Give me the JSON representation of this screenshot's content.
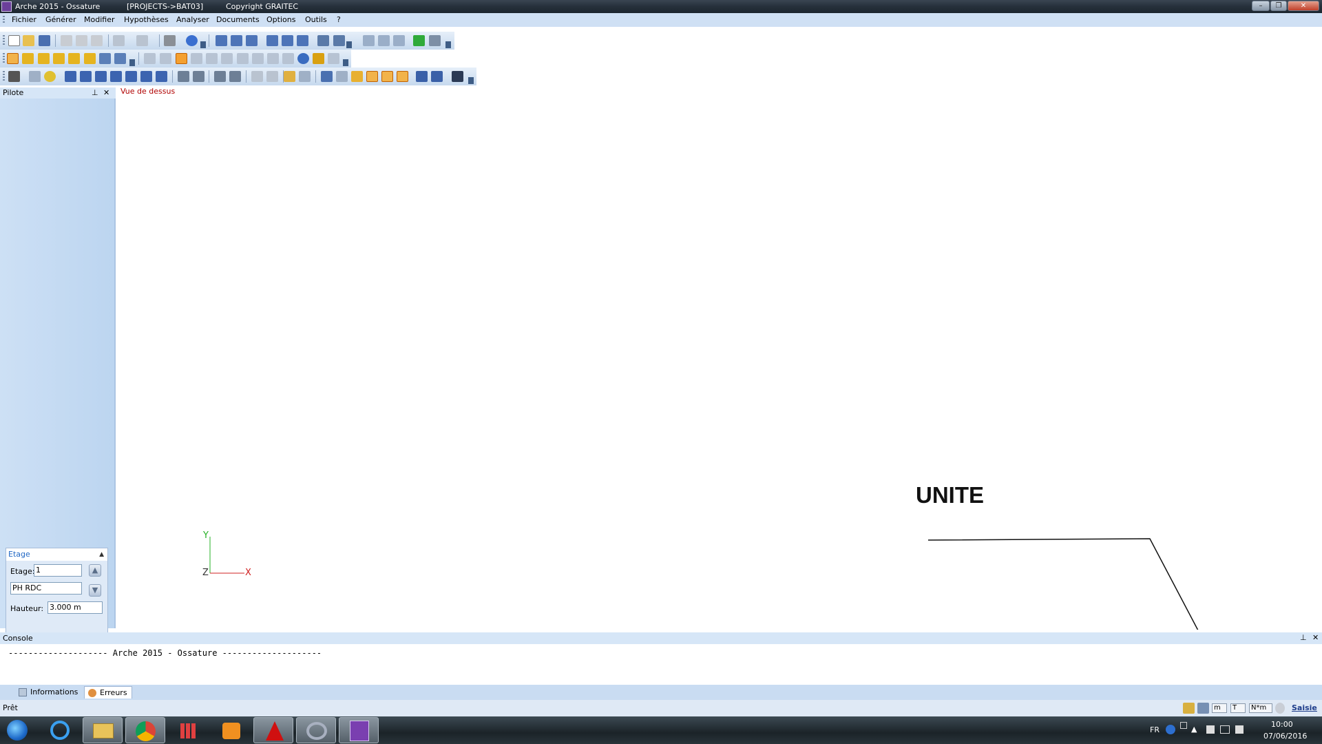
{
  "titlebar": {
    "app_title": "Arche 2015 - Ossature",
    "project": "[PROJECTS->BAT03]",
    "copyright": "Copyright GRAITEC",
    "minimize_icon": "minimize-icon",
    "restore_icon": "restore-icon",
    "close_icon": "close-icon"
  },
  "menu": {
    "items": [
      "Fichier",
      "Générer",
      "Modifier",
      "Hypothèses",
      "Analyser",
      "Documents",
      "Options",
      "Outils",
      "?"
    ]
  },
  "pilot": {
    "title": "Pilote",
    "pin_icon": "pin-icon",
    "close_icon": "close-icon",
    "etage_panel": {
      "title": "Etage",
      "etage_label": "Etage:",
      "etage_value": "1",
      "level_name": "PH RDC",
      "hauteur_label": "Hauteur:",
      "hauteur_value": "3.000 m"
    }
  },
  "canvas": {
    "view_label": "Vue de dessus",
    "axis_y": "Y",
    "axis_z": "Z",
    "axis_x": "X",
    "annotation": "UNITE",
    "colors": {
      "y_axis": "#26b026",
      "x_axis": "#d02020",
      "view_label": "#b00000"
    }
  },
  "console": {
    "title": "Console",
    "line": "-------------------- Arche 2015 - Ossature --------------------",
    "tabs": [
      "Informations",
      "Erreurs"
    ],
    "active_tab": "Erreurs"
  },
  "status": {
    "text": "Prêt",
    "unit_length": "m",
    "unit_force": "T",
    "unit_moment": "N*m",
    "mode": "Saisie"
  },
  "taskbar": {
    "language": "FR",
    "time": "10:00",
    "date": "07/06/2016",
    "apps": [
      "start-orb-icon",
      "internet-explorer-icon",
      "file-explorer-icon",
      "chrome-icon",
      "apps-grid-icon",
      "media-player-icon",
      "autocad-icon",
      "graitec-icon",
      "arche-icon"
    ]
  }
}
